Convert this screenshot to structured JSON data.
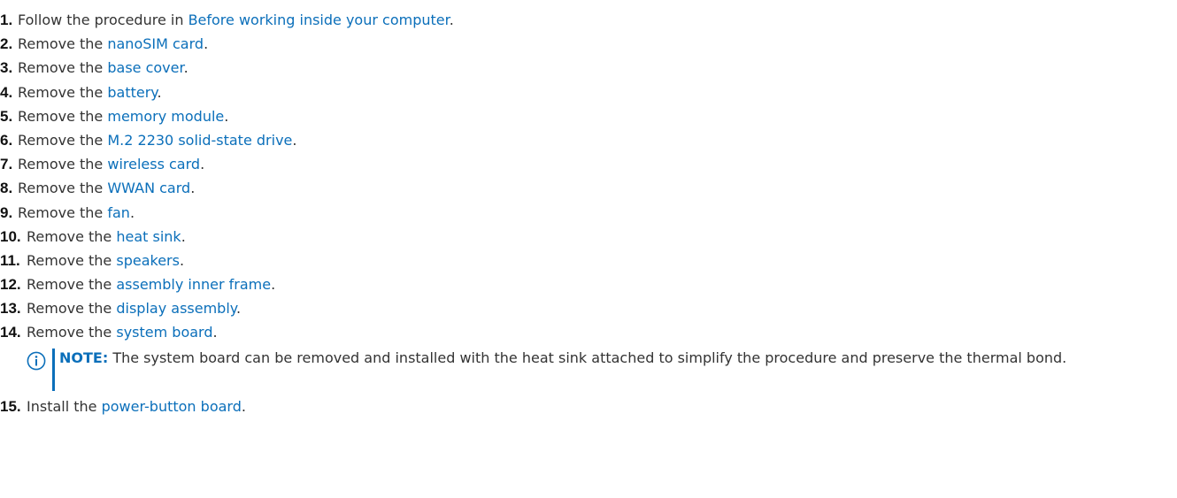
{
  "steps": [
    {
      "num": "1.",
      "prefix": "Follow the procedure in ",
      "link": "Before working inside your computer",
      "suffix": "."
    },
    {
      "num": "2.",
      "prefix": "Remove the ",
      "link": "nanoSIM card",
      "suffix": "."
    },
    {
      "num": "3.",
      "prefix": "Remove the ",
      "link": "base cover",
      "suffix": "."
    },
    {
      "num": "4.",
      "prefix": "Remove the ",
      "link": "battery",
      "suffix": "."
    },
    {
      "num": "5.",
      "prefix": "Remove the ",
      "link": "memory module",
      "suffix": "."
    },
    {
      "num": "6.",
      "prefix": "Remove the ",
      "link": "M.2 2230 solid-state drive",
      "suffix": "."
    },
    {
      "num": "7.",
      "prefix": "Remove the ",
      "link": "wireless card",
      "suffix": "."
    },
    {
      "num": "8.",
      "prefix": "Remove the ",
      "link": "WWAN card",
      "suffix": "."
    },
    {
      "num": "9.",
      "prefix": "Remove the ",
      "link": "fan",
      "suffix": "."
    },
    {
      "num": "10.",
      "prefix": "Remove the ",
      "link": "heat sink",
      "suffix": "."
    },
    {
      "num": "11.",
      "prefix": "Remove the ",
      "link": "speakers",
      "suffix": "."
    },
    {
      "num": "12.",
      "prefix": "Remove the ",
      "link": "assembly inner frame",
      "suffix": "."
    },
    {
      "num": "13.",
      "prefix": "Remove the ",
      "link": "display assembly",
      "suffix": "."
    },
    {
      "num": "14.",
      "prefix": "Remove the ",
      "link": "system board",
      "suffix": "."
    },
    {
      "num": "15.",
      "prefix": "Install the ",
      "link": "power-button board",
      "suffix": "."
    }
  ],
  "note": {
    "label": "NOTE:",
    "text": " The system board can be removed and installed with the heat sink attached to simplify the procedure and preserve the thermal bond.",
    "icon": "info-icon"
  },
  "colors": {
    "link": "#0b6fba",
    "text": "#333333"
  }
}
